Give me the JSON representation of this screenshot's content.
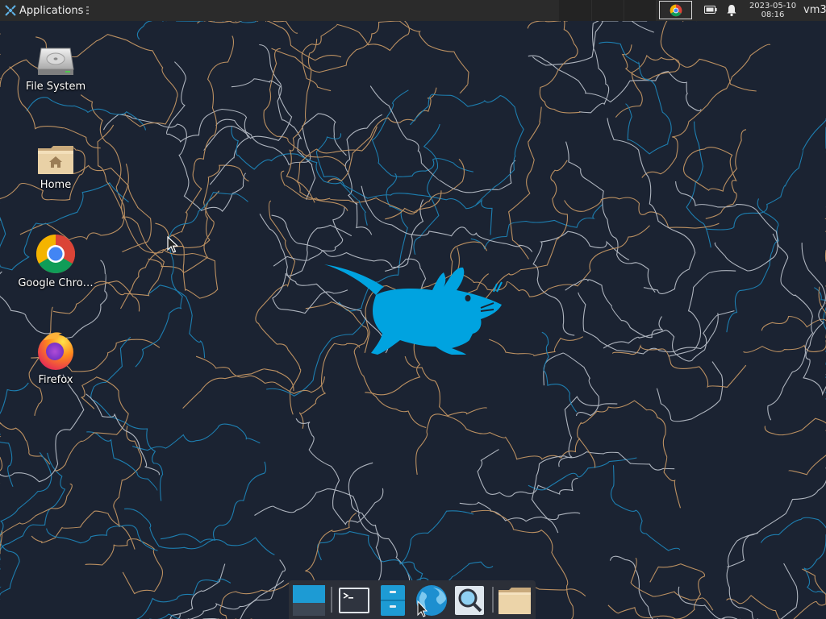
{
  "top_panel": {
    "applications_label": "Applications",
    "clock_date": "2023-05-10",
    "clock_time": "08:16",
    "user": "vm3"
  },
  "desktop_icons": [
    {
      "label": "File System",
      "icon": "drive-harddisk-icon"
    },
    {
      "label": "Home",
      "icon": "home-folder-icon"
    },
    {
      "label": "Google Chro…",
      "icon": "google-chrome-icon"
    },
    {
      "label": "Firefox",
      "icon": "firefox-icon"
    }
  ],
  "dock_items": [
    {
      "name": "show-desktop",
      "icon": "show-desktop-icon"
    },
    {
      "name": "terminal",
      "icon": "terminal-icon"
    },
    {
      "name": "file-manager",
      "icon": "file-manager-icon"
    },
    {
      "name": "web-browser",
      "icon": "web-browser-icon"
    },
    {
      "name": "app-finder",
      "icon": "app-finder-icon"
    },
    {
      "name": "files-folder",
      "icon": "folder-icon"
    }
  ],
  "colors": {
    "panel_bg": "#2b2b2b",
    "wallpaper_bg": "#1b2332",
    "xfce_mouse": "#00a3e0",
    "contour_orange": "#d7a36a",
    "contour_white": "#c9cfd8",
    "contour_blue": "#1e8fc7"
  }
}
